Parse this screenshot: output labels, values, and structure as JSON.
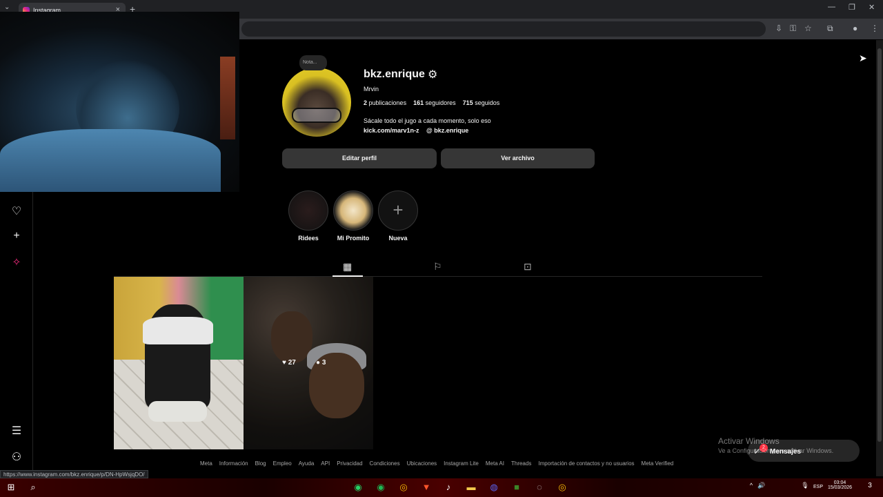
{
  "browser": {
    "tab_title": "Instagram",
    "status_url": "https://www.instagram.com/bkz.enrique/p/DN-HpWsjqDO/"
  },
  "profile": {
    "note": "Nota...",
    "username": "bkz.enrique",
    "full_name": "Mrvin",
    "stats": [
      {
        "count": "2",
        "label": "publicaciones"
      },
      {
        "count": "161",
        "label": "seguidores"
      },
      {
        "count": "715",
        "label": "seguidos"
      }
    ],
    "bio": "Sácale todo el jugo a cada momento, solo eso",
    "link": "kick.com/marv1n-z",
    "threads_handle": "bkz.enrique",
    "edit_button": "Editar perfil",
    "archive_button": "Ver archivo"
  },
  "highlights": [
    {
      "label": "Ridees"
    },
    {
      "label": "Mi Promito"
    },
    {
      "label": "Nueva"
    }
  ],
  "post_overlay": {
    "likes": "27",
    "comments": "3"
  },
  "footer_links": [
    "Meta",
    "Información",
    "Blog",
    "Empleo",
    "Ayuda",
    "API",
    "Privacidad",
    "Condiciones",
    "Ubicaciones",
    "Instagram Lite",
    "Meta AI",
    "Threads",
    "Importación de contactos y no usuarios",
    "Meta Verified"
  ],
  "watermark": {
    "line1": "Activar Windows",
    "line2": "Ve a Configuración para activar Windows."
  },
  "messages": {
    "label": "Mensajes",
    "badge": "2"
  },
  "taskbar": {
    "lang": "ESP",
    "time": "03:04",
    "date": "15/03/2026",
    "notifications": "3"
  }
}
